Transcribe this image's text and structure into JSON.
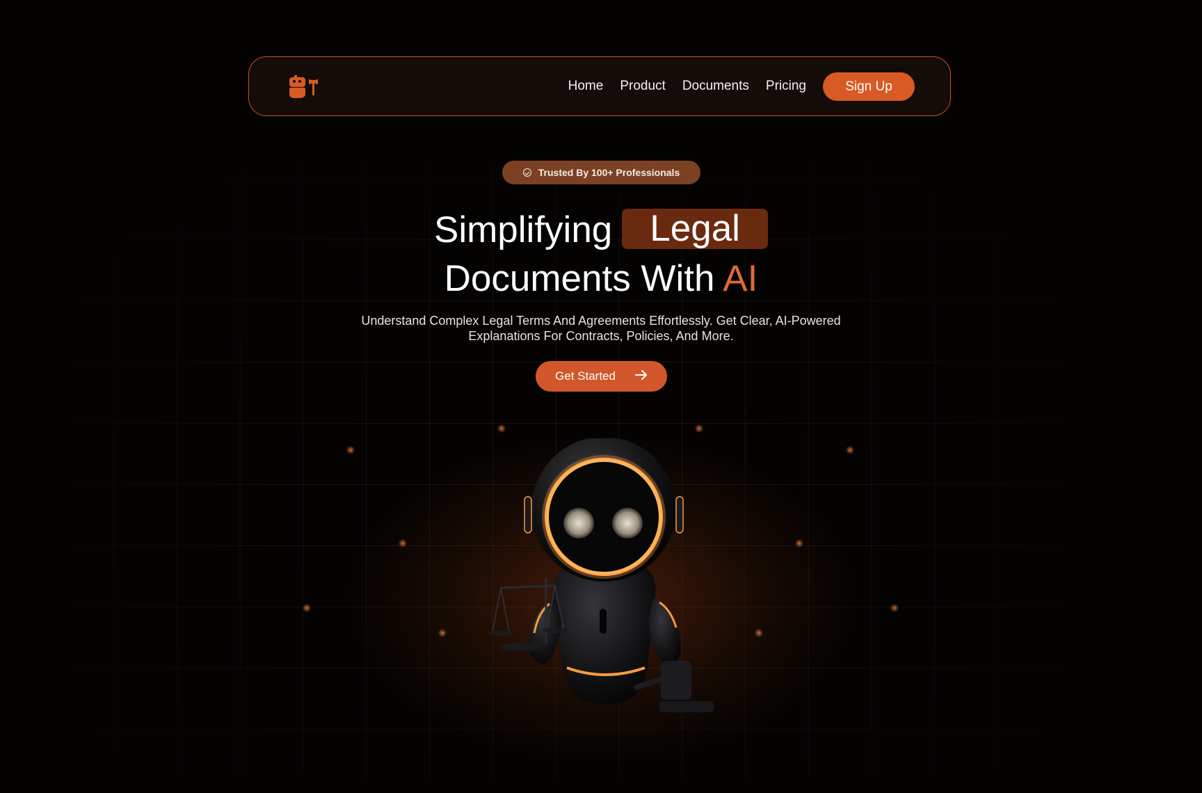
{
  "nav": {
    "links": [
      "Home",
      "Product",
      "Documents",
      "Pricing"
    ],
    "signup_label": "Sign Up"
  },
  "hero": {
    "badge": "Trusted By 100+ Professionals",
    "headline_part1": "Simplifying",
    "headline_highlight": "Legal",
    "headline_part2": "Documents With",
    "headline_accent": "AI",
    "subtitle": "Understand Complex Legal Terms And Agreements Effortlessly. Get Clear, AI-Powered Explanations For Contracts, Policies, And More.",
    "cta_label": "Get Started"
  },
  "colors": {
    "accent": "#d85a24",
    "badge_bg": "#7c4123",
    "highlight_bg": "#6a2a10",
    "background": "#050302"
  },
  "icons": [
    "robot-gavel-logo-icon",
    "check-circle-icon",
    "arrow-right-icon",
    "robot-judge-illustration"
  ]
}
